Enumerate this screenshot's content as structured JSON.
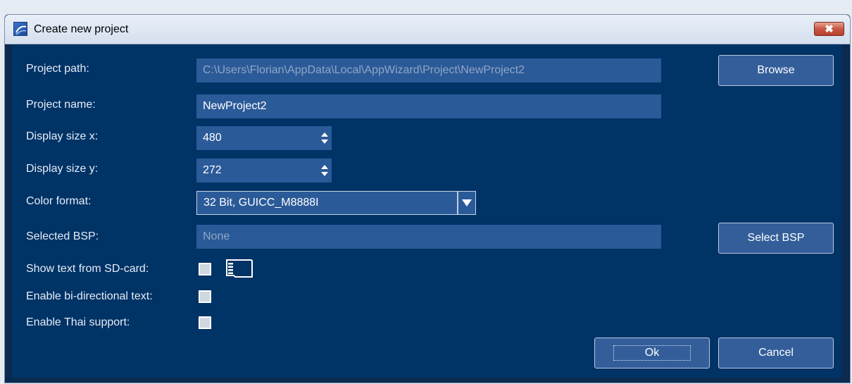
{
  "window": {
    "title": "Create new project",
    "close_glyph": "✖"
  },
  "form": {
    "project_path": {
      "label": "Project path:",
      "value": "C:\\Users\\Florian\\AppData\\Local\\AppWizard\\Project\\NewProject2"
    },
    "project_name": {
      "label": "Project name:",
      "value": "NewProject2"
    },
    "display_size_x": {
      "label": "Display size x:",
      "value": "480"
    },
    "display_size_y": {
      "label": "Display size y:",
      "value": "272"
    },
    "color_format": {
      "label": "Color format:",
      "value": "32 Bit, GUICC_M8888I"
    },
    "selected_bsp": {
      "label": "Selected BSP:",
      "value": "None"
    },
    "show_text_sd": {
      "label": "Show text from SD-card:",
      "checked": false,
      "icon": "sd-card-icon"
    },
    "bidi_text": {
      "label": "Enable bi-directional text:",
      "checked": false
    },
    "thai_support": {
      "label": "Enable Thai support:",
      "checked": false
    }
  },
  "buttons": {
    "browse": "Browse",
    "select_bsp": "Select BSP",
    "ok": "Ok",
    "cancel": "Cancel"
  },
  "colors": {
    "client_bg": "#003366",
    "field_bg": "#2b5a98",
    "button_bg": "#335e9a"
  }
}
